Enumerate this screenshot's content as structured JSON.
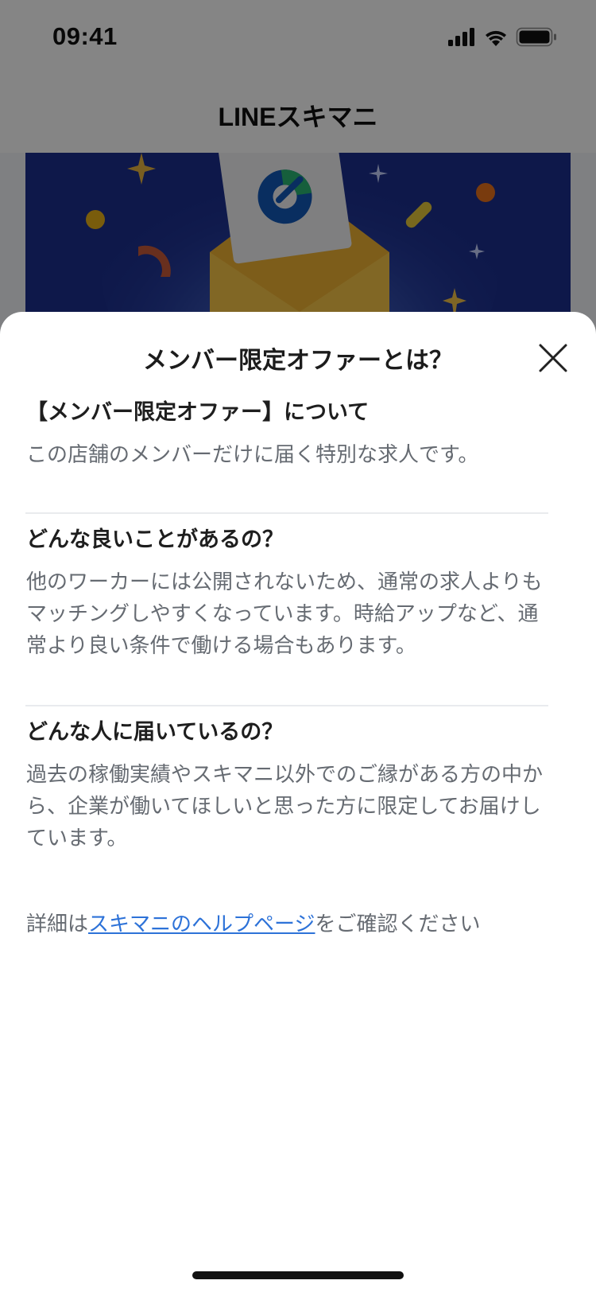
{
  "status_bar": {
    "time": "09:41",
    "icons": [
      "signal-icon",
      "wifi-icon",
      "battery-icon"
    ]
  },
  "header": {
    "title": "LINEスキマニ"
  },
  "colors": {
    "banner_navy": "#1c2f8f",
    "link_blue": "#2d72d8",
    "overlay": "rgba(0,0,0,0.48)",
    "body_gray": "#666b72"
  },
  "modal": {
    "title": "メンバー限定オファーとは？",
    "close_icon": "close-icon",
    "sections": [
      {
        "heading": "【メンバー限定オファー】について",
        "body": "この店舗のメンバーだけに届く特別な求人です。"
      },
      {
        "heading": "どんな良いことがあるの？",
        "body": "他のワーカーには公開されないため、通常の求人よりもマッチングしやすくなっています。時給アップなど、通常より良い条件で働ける場合もあります。"
      },
      {
        "heading": "どんな人に届いているの？",
        "body": "過去の稼働実績やスキマニ以外でのご縁がある方の中から、企業が働いてほしいと思った方に限定してお届けしています。"
      }
    ],
    "help": {
      "prefix": "詳細は",
      "link_label": "スキマニのヘルプページ",
      "suffix": "をご確認ください"
    }
  }
}
